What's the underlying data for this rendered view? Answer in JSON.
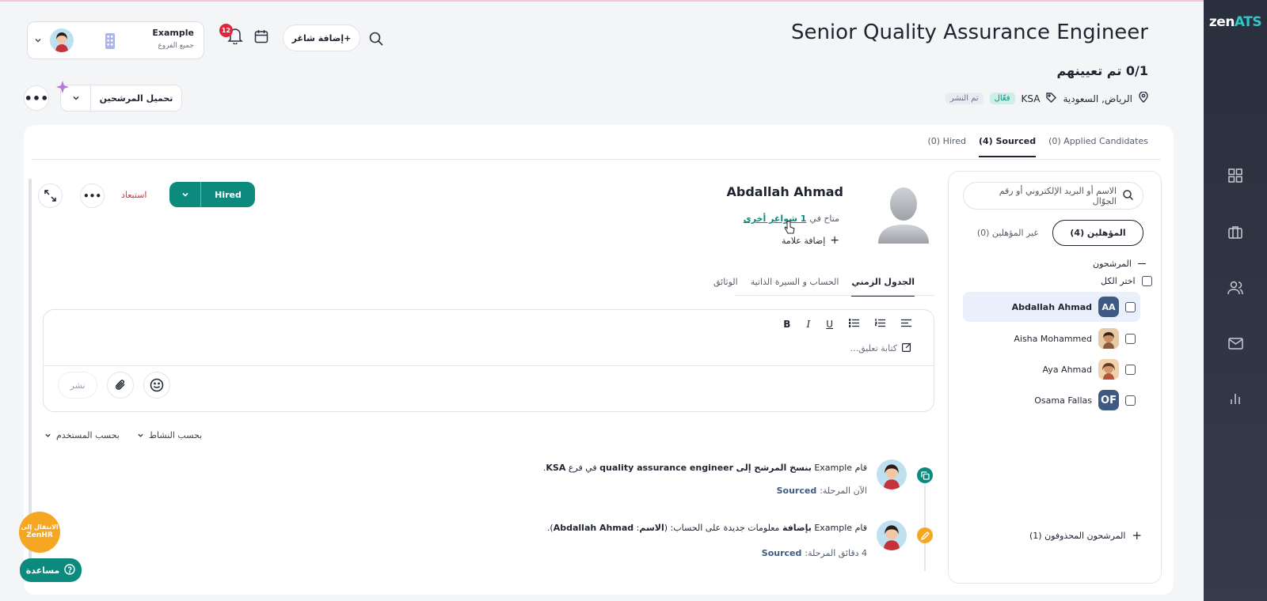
{
  "app": {
    "logo_a": "zen",
    "logo_b": "ATS"
  },
  "header": {
    "company_name": "Example",
    "branch_label": "جميع الفروع",
    "notifications_count": "12",
    "add_vacancy": "إضافة شاغر+",
    "load_candidates": "تحميل المرشحين"
  },
  "job": {
    "title": "Senior Quality Assurance Engineer",
    "assigned": "0/1 تم تعيينهم",
    "location": "الرياض, السعودية",
    "tag": "KSA",
    "status_active": "فعّال",
    "status_published": "تم النشر"
  },
  "tabs": [
    {
      "label": "(0) Applied Candidates"
    },
    {
      "label": "(4) Sourced"
    },
    {
      "label": "(0) Hired"
    }
  ],
  "panel": {
    "search_placeholder": "الاسم أو البريد الإلكتروني أو رقم الجوّال",
    "qualified": "المؤهلين (4)",
    "unqualified": "غير المؤهلين (0)",
    "candidates_header": "المرشحون",
    "select_all": "اختر الكل",
    "deleted": "المرشحون المحذوفون (1)",
    "candidates": [
      {
        "name": "Abdallah Ahmad",
        "initials": "AA",
        "color": "#3e5a82"
      },
      {
        "name": "Aisha Mohammed",
        "initials": "",
        "color": "#d9a57b"
      },
      {
        "name": "Aya Ahmad",
        "initials": "",
        "color": "#d9a57b"
      },
      {
        "name": "Osama Fallas",
        "initials": "OF",
        "color": "#3e5a82"
      }
    ]
  },
  "profile": {
    "name": "Abdallah Ahmad",
    "available_prefix": "متاح في",
    "available_link": "1 شواغر أخرى",
    "add_tag": "إضافة علامة",
    "hired_button": "Hired",
    "exclude": "استبعاد",
    "tabs": [
      "الجدول الزمني",
      "الحساب و السيرة الذاتية",
      "الوثائق"
    ],
    "editor_placeholder": "كتابة تعليق...",
    "publish": "نشر",
    "filter_activity": "بحسب النشاط",
    "filter_user": "بحسب المستخدم"
  },
  "timeline": [
    {
      "p1": "قام Example ",
      "b1": "بنسخ المرشح إلى",
      "p2": " ",
      "b2": "quality assurance engineer",
      "p3": " في فرع ",
      "b3": "KSA",
      "p4": ".",
      "sub_prefix": "الآن المرحلة:",
      "stage": "Sourced"
    },
    {
      "p1": "قام Example ",
      "b1": "بإضافة",
      "p2": " معلومات جديدة على الحساب: (",
      "b2": "الاسم",
      "p3": ": ",
      "b3": "Abdallah Ahmad",
      "p4": ").",
      "sub_prefix": "4 دقائق المرحلة:",
      "stage": "Sourced"
    }
  ],
  "floating": {
    "zenhr_l1": "الانتقال إلى",
    "zenhr_l2": "ZenHR",
    "help": "مساعدة"
  },
  "colors": {
    "accent": "#0d8a7e",
    "danger": "#d9363e",
    "rail": "#2f3443",
    "badge": "#e0243a"
  }
}
